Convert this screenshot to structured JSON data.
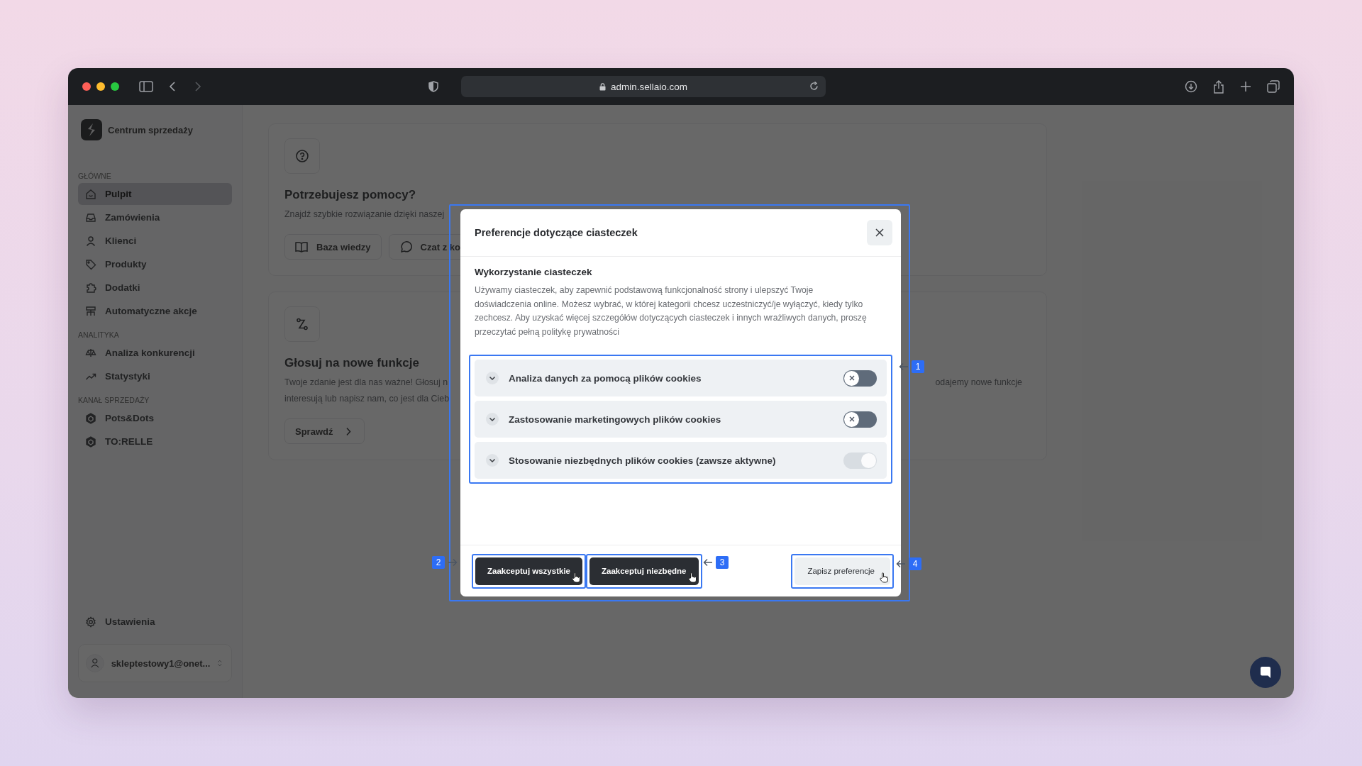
{
  "browser": {
    "url": "admin.sellaio.com"
  },
  "sidebar": {
    "brand": "Centrum sprzedaży",
    "sections": [
      {
        "heading": "GŁÓWNE",
        "items": [
          {
            "label": "Pulpit",
            "selected": true
          },
          {
            "label": "Zamówienia",
            "selected": false
          },
          {
            "label": "Klienci",
            "selected": false
          },
          {
            "label": "Produkty",
            "selected": false
          },
          {
            "label": "Dodatki",
            "selected": false
          },
          {
            "label": "Automatyczne akcje",
            "selected": false
          }
        ]
      },
      {
        "heading": "ANALITYKA",
        "items": [
          {
            "label": "Analiza konkurencji",
            "selected": false
          },
          {
            "label": "Statystyki",
            "selected": false
          }
        ]
      },
      {
        "heading": "KANAŁ SPRZEDAŻY",
        "items": [
          {
            "label": "Pots&Dots",
            "selected": false
          },
          {
            "label": "TO:RELLE",
            "selected": false
          }
        ]
      }
    ],
    "settings": "Ustawienia",
    "account": "skleptestowy1@onet..."
  },
  "cards": [
    {
      "title": "Potrzebujesz pomocy?",
      "text": [
        "Znajdź szybkie rozwiązanie dzięki naszej"
      ],
      "buttons": [
        "Baza wiedzy",
        "Czat z ko"
      ]
    },
    {
      "title": "Głosuj na nowe funkcje",
      "text": [
        "Twoje zdanie jest dla nas ważne! Głosuj n",
        "interesują lub napisz nam, co jest dla Cieb"
      ],
      "text_continued": "odajemy nowe funkcje",
      "buttons": [
        "Sprawdź"
      ]
    }
  ],
  "modal": {
    "title": "Preferencje dotyczące ciasteczek",
    "heading": "Wykorzystanie ciasteczek",
    "text": "Używamy ciasteczek, aby zapewnić podstawową funkcjonalność strony i ulepszyć Twoje doświadczenia online. Możesz wybrać, w której kategorii chcesz uczestniczyć/je wyłączyć, kiedy tylko zechcesz. Aby uzyskać więcej szczegółów dotyczących ciasteczek i innych wrażliwych danych, proszę przeczytać pełną politykę prywatności",
    "options": [
      {
        "label": "Analiza danych za pomocą plików cookies",
        "on": false,
        "disabled": false
      },
      {
        "label": "Zastosowanie marketingowych plików cookies",
        "on": false,
        "disabled": false
      },
      {
        "label": "Stosowanie niezbędnych plików cookies (zawsze aktywne)",
        "on": true,
        "disabled": true
      }
    ],
    "buttons": [
      {
        "label": "Zaakceptuj wszystkie",
        "kind": "primary"
      },
      {
        "label": "Zaakceptuj niezbędne",
        "kind": "primary"
      },
      {
        "label": "Zapisz preferencje",
        "kind": "secondary"
      }
    ]
  },
  "callouts": [
    "1",
    "2",
    "3",
    "4"
  ]
}
